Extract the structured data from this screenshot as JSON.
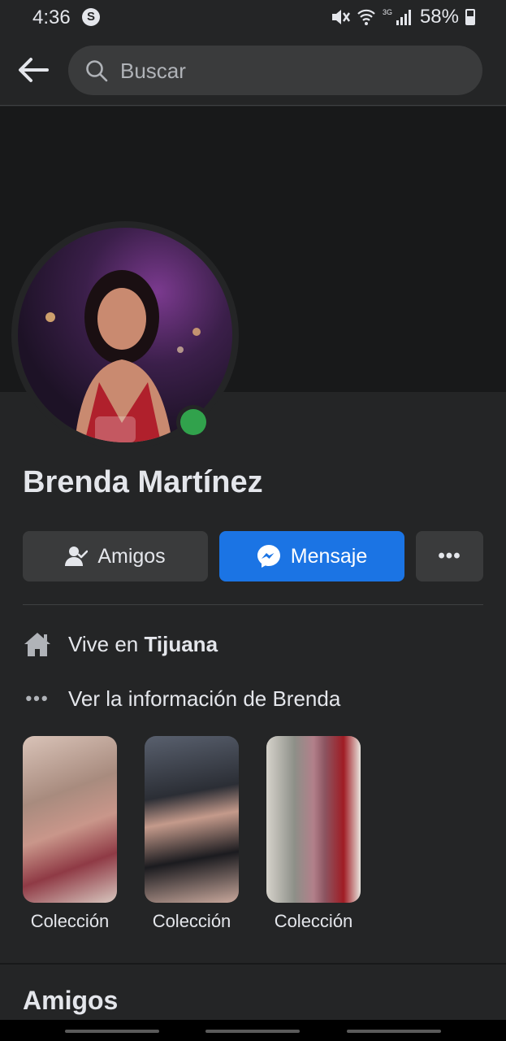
{
  "status_bar": {
    "time": "4:36",
    "app_icon_letter": "S",
    "network": "3G",
    "battery": "58%",
    "battery_level": 0.58
  },
  "header": {
    "search_placeholder": "Buscar"
  },
  "profile": {
    "name": "Brenda Martínez",
    "online": true,
    "online_color": "#31a24c"
  },
  "actions": {
    "friends_label": "Amigos",
    "message_label": "Mensaje",
    "more_label": "•••"
  },
  "details": {
    "live_prefix": "Vive en ",
    "live_city": "Tijuana",
    "about": "Ver la información de Brenda"
  },
  "collections": [
    {
      "label": "Colección"
    },
    {
      "label": "Colección"
    },
    {
      "label": "Colección"
    }
  ],
  "sections": {
    "friends_title": "Amigos"
  },
  "colors": {
    "background": "#242526",
    "cover": "#18191a",
    "accent": "#1b74e4",
    "secondary_button": "#3a3b3c"
  }
}
